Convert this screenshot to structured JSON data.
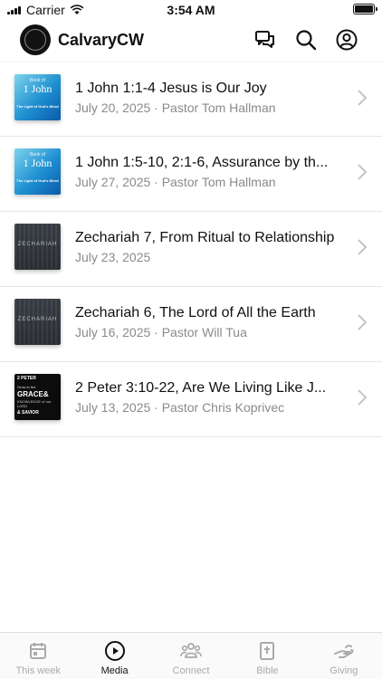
{
  "status_bar": {
    "carrier": "Carrier",
    "time": "3:54 AM"
  },
  "header": {
    "title": "CalvaryCW",
    "icons": [
      "chat-icon",
      "search-icon",
      "profile-icon"
    ]
  },
  "sermons": [
    {
      "title": "1 John 1:1-4 Jesus is Our Joy",
      "meta": "July 20, 2025 · Pastor Tom Hallman",
      "thumb": "1 John"
    },
    {
      "title": "1 John 1:5-10, 2:1-6, Assurance by th...",
      "meta": "July 27, 2025 · Pastor Tom Hallman",
      "thumb": "1 John"
    },
    {
      "title": "Zechariah 7, From Ritual to Relationship",
      "meta": "July 23, 2025",
      "thumb": "Zechariah"
    },
    {
      "title": "Zechariah 6, The Lord of All the Earth",
      "meta": "July 16, 2025 · Pastor Will Tua",
      "thumb": "Zechariah"
    },
    {
      "title": "2 Peter 3:10-22, Are We Living Like J...",
      "meta": "July 13, 2025 · Pastor Chris Koprivec",
      "thumb": "2 Peter"
    }
  ],
  "thumb_text": {
    "john_small": "Book of",
    "john_big": "1 John",
    "john_sub": "The Light of God's Word",
    "zech": "ZECHARIAH",
    "peter_top": "2 PETER",
    "peter_grow": "Grow in the",
    "peter_grace": "GRACE&",
    "peter_knowledge": "KNOWLEDGE of our LORD",
    "peter_savior": "& SAVIOR"
  },
  "tabs": [
    {
      "label": "This week",
      "icon": "calendar-icon",
      "active": false
    },
    {
      "label": "Media",
      "icon": "play-icon",
      "active": true
    },
    {
      "label": "Connect",
      "icon": "people-icon",
      "active": false
    },
    {
      "label": "Bible",
      "icon": "bible-icon",
      "active": false
    },
    {
      "label": "Giving",
      "icon": "giving-icon",
      "active": false
    }
  ],
  "colors": {
    "accent": "#111111",
    "muted": "#8a8a8a",
    "inactive_tab": "#aaaaaa"
  }
}
